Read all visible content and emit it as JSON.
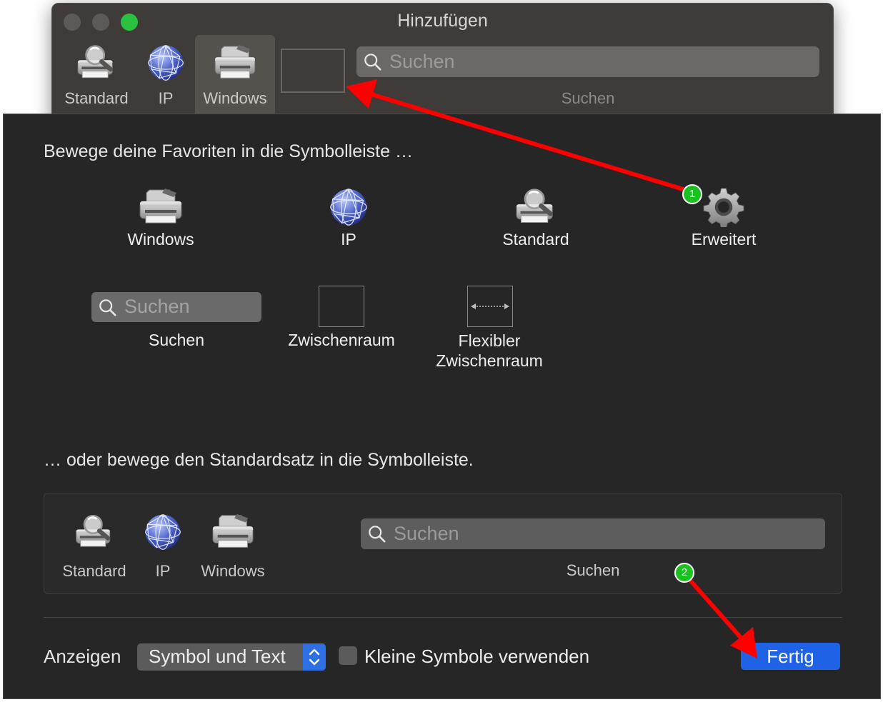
{
  "window": {
    "title": "Hinzufügen",
    "toolbar": {
      "items": [
        {
          "label": "Standard",
          "icon": "printer-magnifier-icon"
        },
        {
          "label": "IP",
          "icon": "globe-icon"
        },
        {
          "label": "Windows",
          "icon": "printer-icon",
          "selected": true
        }
      ],
      "search_placeholder": "Suchen",
      "search_label": "Suchen"
    }
  },
  "sheet": {
    "favorites_heading": "Bewege deine Favoriten in die Symbolleiste …",
    "favorites": [
      {
        "label": "Windows",
        "icon": "printer-icon"
      },
      {
        "label": "IP",
        "icon": "globe-icon"
      },
      {
        "label": "Standard",
        "icon": "printer-magnifier-icon"
      },
      {
        "label": "Erweitert",
        "icon": "gear-icon"
      }
    ],
    "palette": {
      "search_placeholder": "Suchen",
      "search_label": "Suchen",
      "space_label": "Zwischenraum",
      "flexible_space_label_line1": "Flexibler",
      "flexible_space_label_line2": "Zwischenraum"
    },
    "default_heading": "… oder bewege den Standardsatz in die Symbolleiste.",
    "default_set": {
      "items": [
        {
          "label": "Standard",
          "icon": "printer-magnifier-icon"
        },
        {
          "label": "IP",
          "icon": "globe-icon"
        },
        {
          "label": "Windows",
          "icon": "printer-icon"
        }
      ],
      "search_placeholder": "Suchen",
      "search_label": "Suchen"
    },
    "footer": {
      "show_label": "Anzeigen",
      "show_value": "Symbol und Text",
      "small_icons_label": "Kleine Symbole verwenden",
      "small_icons_checked": false,
      "done_label": "Fertig"
    }
  },
  "annotations": {
    "badge_1": "1",
    "badge_2": "2",
    "arrow_color": "#ff0000",
    "badge_color": "#19c21e"
  },
  "colors": {
    "accent": "#1f62e6",
    "traffic_zoom": "#29c33f"
  }
}
